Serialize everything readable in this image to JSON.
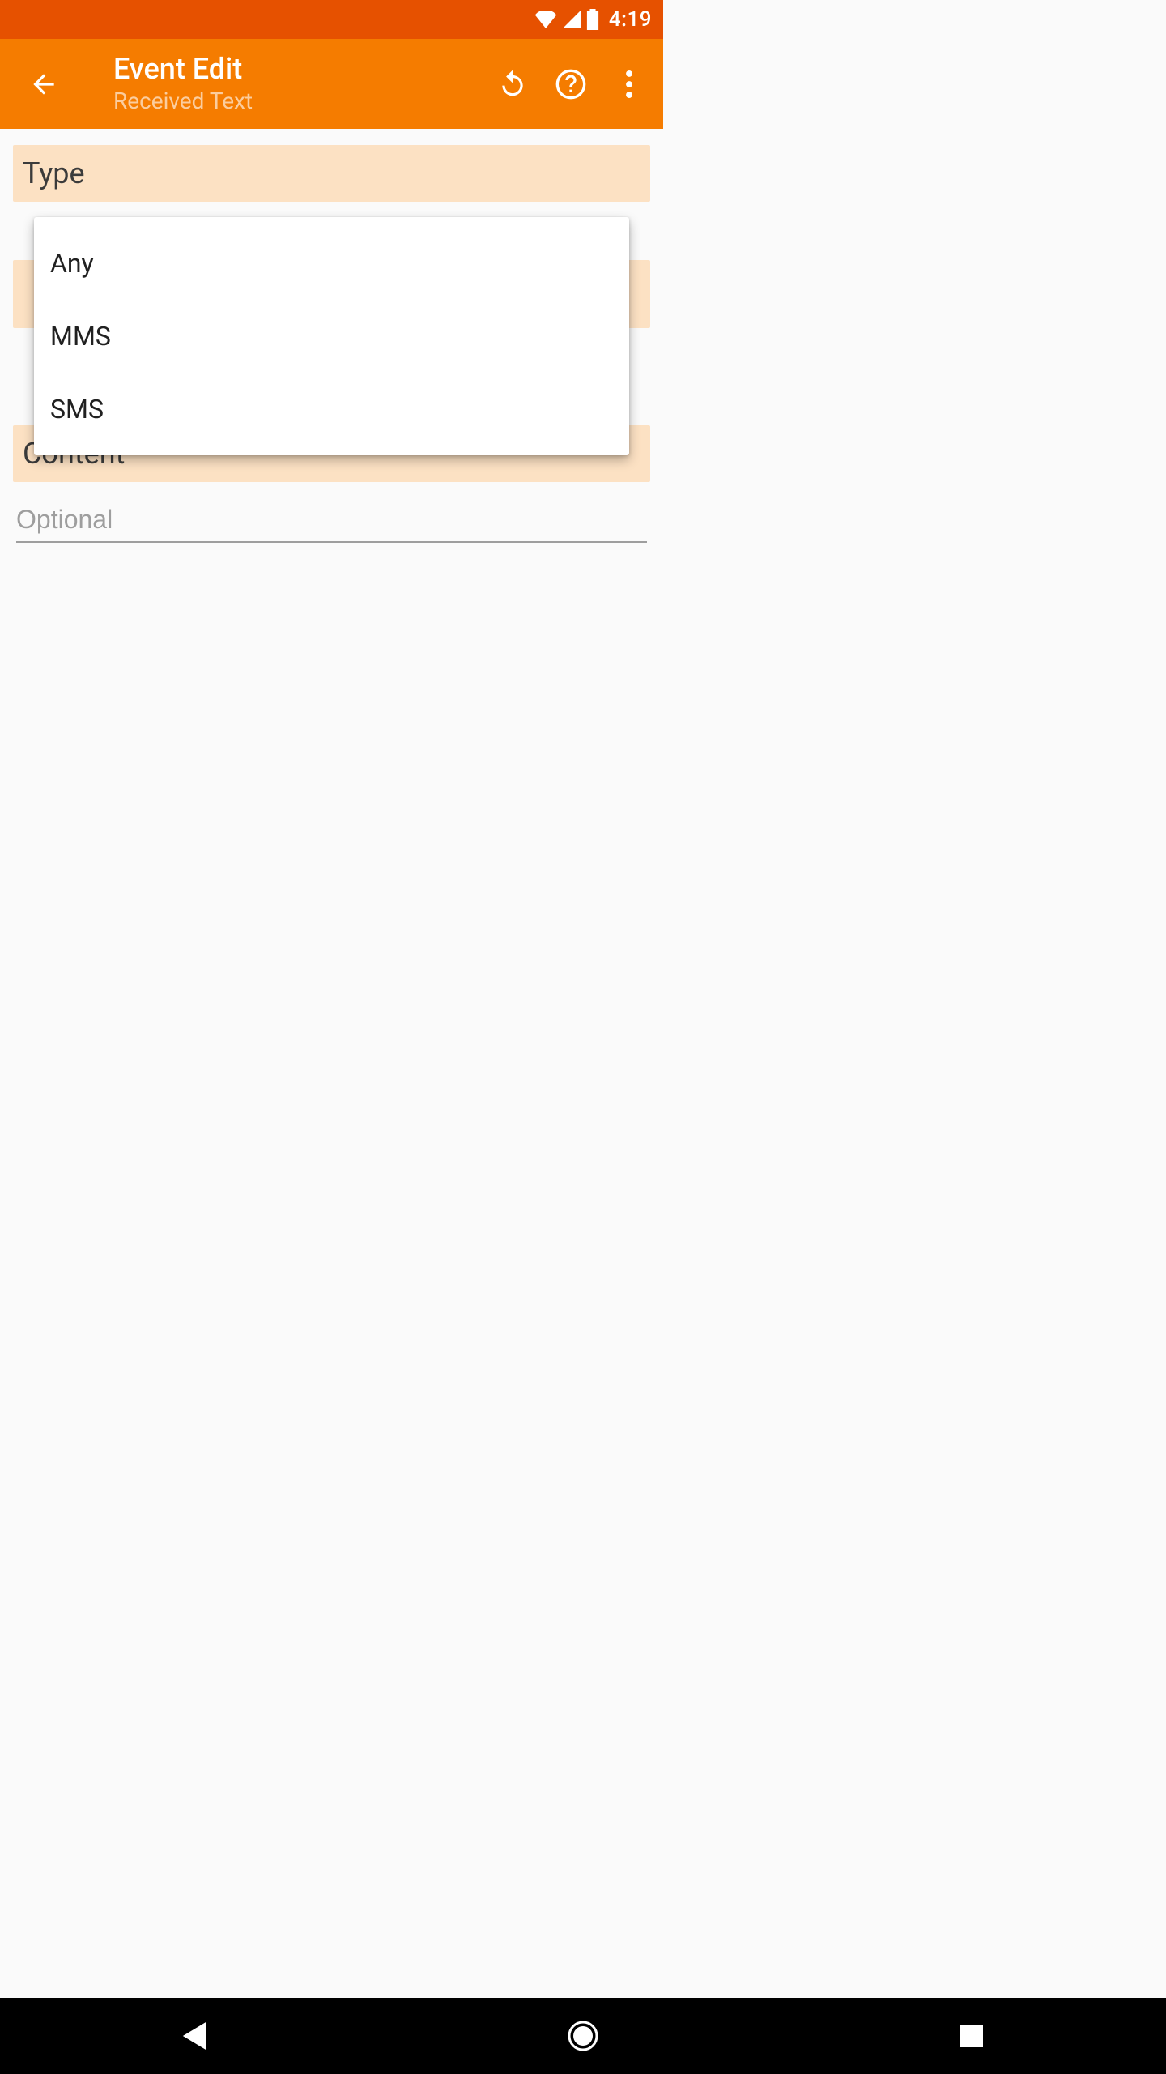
{
  "status": {
    "time": "4:19"
  },
  "header": {
    "title": "Event Edit",
    "subtitle": "Received Text"
  },
  "sections": {
    "type_label": "Type",
    "content_label": "Content",
    "content_placeholder": "Optional"
  },
  "dropdown": {
    "options": [
      "Any",
      "MMS",
      "SMS"
    ]
  },
  "colors": {
    "status_bar": "#e65100",
    "action_bar": "#f57c00",
    "section_bg": "#fce1c3"
  }
}
